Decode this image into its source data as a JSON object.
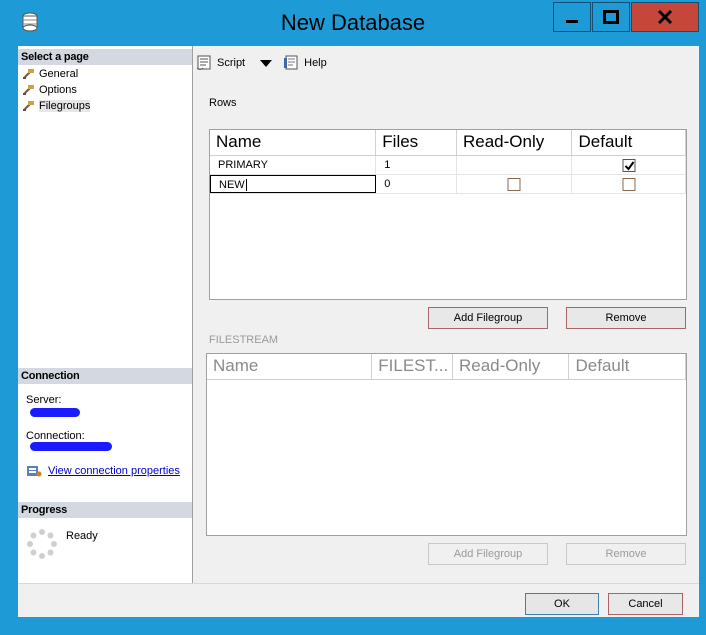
{
  "window": {
    "title": "New Database",
    "icons": {
      "app": "database-icon",
      "minimize": "minimize-icon",
      "maximize": "maximize-icon",
      "close": "close-icon"
    }
  },
  "left": {
    "select_page_header": "Select a page",
    "pages": [
      {
        "label": "General",
        "icon": "page-icon"
      },
      {
        "label": "Options",
        "icon": "page-icon"
      },
      {
        "label": "Filegroups",
        "icon": "page-icon",
        "selected": true
      }
    ],
    "connection_header": "Connection",
    "server_label": "Server:",
    "connection_label": "Connection:",
    "view_connection_properties": "View connection properties",
    "progress_header": "Progress",
    "progress_status": "Ready"
  },
  "toolbar": {
    "script_label": "Script",
    "help_label": "Help"
  },
  "rows": {
    "label": "Rows",
    "columns": [
      "Name",
      "Files",
      "Read-Only",
      "Default"
    ],
    "data": [
      {
        "name": "PRIMARY",
        "files": "1",
        "read_only": null,
        "default": true
      },
      {
        "name": "NEW",
        "files": "0",
        "read_only": false,
        "default": false
      }
    ],
    "add_label": "Add Filegroup",
    "remove_label": "Remove"
  },
  "filestream": {
    "label": "FILESTREAM",
    "columns": [
      "Name",
      "FILEST...",
      "Read-Only",
      "Default"
    ],
    "add_label": "Add Filegroup",
    "remove_label": "Remove"
  },
  "footer": {
    "ok_label": "OK",
    "cancel_label": "Cancel"
  },
  "colors": {
    "frame": "#1e9ad6",
    "close": "#c7463a",
    "redaction": "#1b1bff"
  }
}
